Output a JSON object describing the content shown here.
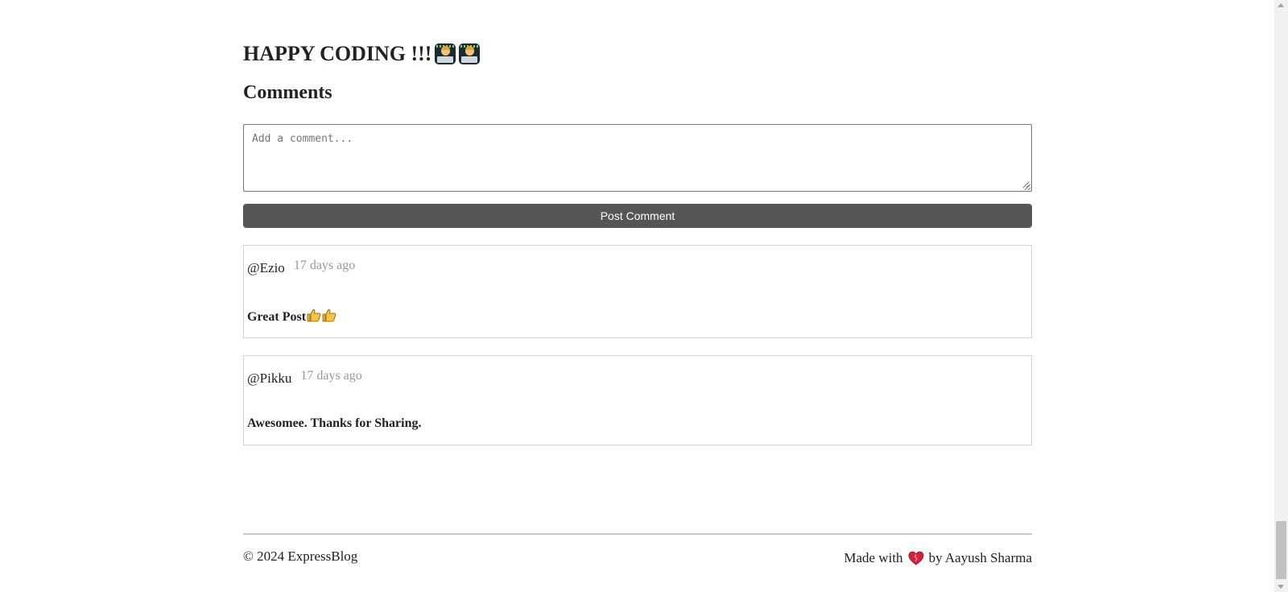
{
  "post": {
    "closing_text": "HAPPY CODING !!!",
    "closing_emojis": [
      "technologist-emoji",
      "technologist-emoji"
    ]
  },
  "comments": {
    "heading": "Comments",
    "input_placeholder": "Add a comment...",
    "input_value": "",
    "submit_label": "Post Comment",
    "items": [
      {
        "user": "@Ezio",
        "time": "17 days ago",
        "text": "Great Post",
        "emojis": [
          "thumbs-up",
          "thumbs-up"
        ]
      },
      {
        "user": "@Pikku",
        "time": "17 days ago",
        "text": "Awesomee. Thanks for Sharing.",
        "emojis": []
      }
    ]
  },
  "footer": {
    "copyright": "© 2024 ExpressBlog",
    "made_with": "Made with",
    "heart_icon": "heart-icon",
    "author": "by Aayush Sharma"
  },
  "colors": {
    "button_bg": "#555555",
    "button_text": "#ffffff",
    "timestamp": "#999999",
    "card_border": "#d3d3d3",
    "heart": "#d81e3a"
  }
}
